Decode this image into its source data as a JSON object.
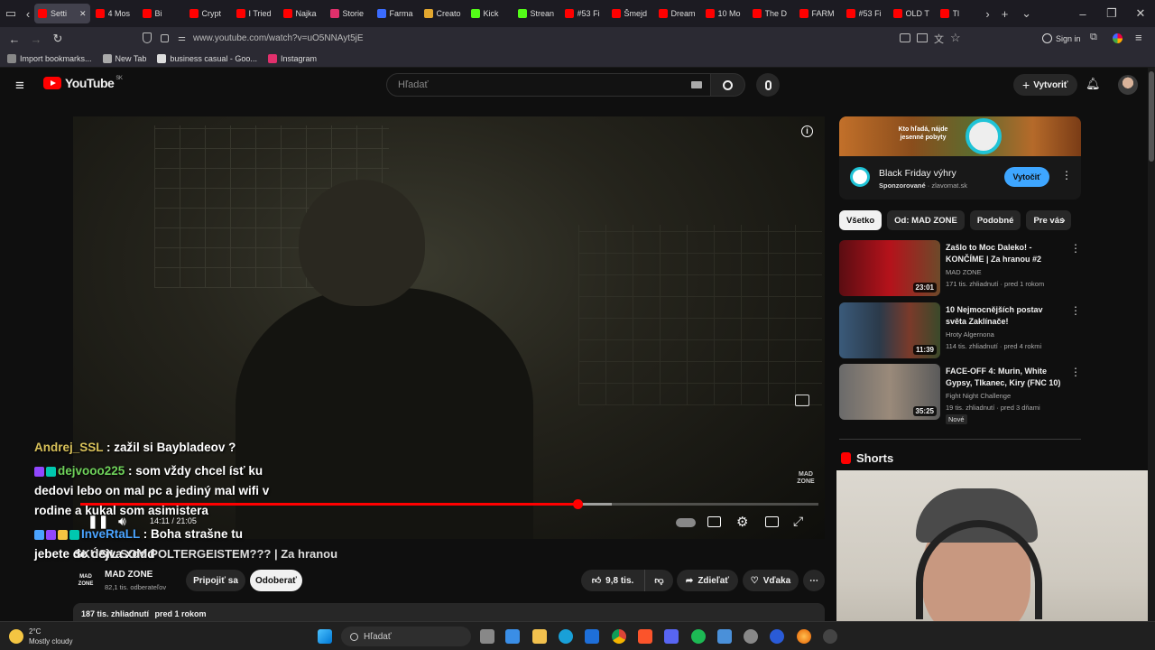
{
  "browser": {
    "tabs": [
      {
        "title": "Setti",
        "color": "#ff0000",
        "active": true
      },
      {
        "title": "4 Mos",
        "color": "#ff0000"
      },
      {
        "title": "Bi",
        "color": "#ff0000"
      },
      {
        "title": "Crypt",
        "color": "#ff0000"
      },
      {
        "title": "I Tried",
        "color": "#ff0000"
      },
      {
        "title": "Najka",
        "color": "#ff0000"
      },
      {
        "title": "Storie",
        "color": "#e1306c"
      },
      {
        "title": "Farma",
        "color": "#3b6cff"
      },
      {
        "title": "Creato",
        "color": "#e3a72f"
      },
      {
        "title": "Kick",
        "color": "#53fc18"
      },
      {
        "title": "Strean",
        "color": "#53fc18"
      },
      {
        "title": "#53 Fi",
        "color": "#ff0000"
      },
      {
        "title": "Šmejd",
        "color": "#ff0000"
      },
      {
        "title": "Dream",
        "color": "#ff0000"
      },
      {
        "title": "10 Mo",
        "color": "#ff0000"
      },
      {
        "title": "The D",
        "color": "#ff0000"
      },
      {
        "title": "FARM",
        "color": "#ff0000"
      },
      {
        "title": "#53 Fi",
        "color": "#ff0000"
      },
      {
        "title": "OLD T",
        "color": "#ff0000"
      },
      {
        "title": "Tl",
        "color": "#ff0000"
      }
    ],
    "url": "www.youtube.com/watch?v=uO5NNAyt5jE",
    "sign_in": "Sign in",
    "bookmarks": [
      {
        "label": "Import bookmarks...",
        "color": "#888888"
      },
      {
        "label": "New Tab",
        "color": "#aaaaaa"
      },
      {
        "label": "business casual - Goo...",
        "color": "#dddddd"
      },
      {
        "label": "Instagram",
        "color": "#e1306c"
      }
    ]
  },
  "youtube": {
    "logo_text": "YouTube",
    "region": "SK",
    "search_placeholder": "Hľadať",
    "create_label": "Vytvoriť",
    "video": {
      "time_current": "14:11",
      "time_total": "21:05",
      "timecode": "14:11 / 21:05",
      "progress_fraction": 0.673,
      "buffered_fraction": 0.72,
      "watermark": "MAD ZONE",
      "title": "SKÚSIL SOM POLTERGEISTEM??? | Za hranou"
    },
    "channel": {
      "name": "MAD ZONE",
      "subscribers": "82,1 tis. odberateľov",
      "join_label": "Pripojiť sa",
      "subscribe_label": "Odoberať",
      "likes": "9,8 tis.",
      "share_label": "Zdieľať",
      "thanks_label": "Vďaka"
    },
    "description": {
      "views": "187 tis. zhliadnutí",
      "date": "pred 1 rokom"
    },
    "ad": {
      "banner_text": "Kto hľadá, nájde jesenné pobyty",
      "title": "Black Friday výhry",
      "sponsored": "Sponzorované",
      "domain": "zlavomat.sk",
      "cta": "Vytočiť"
    },
    "chips": [
      "Všetko",
      "Od: MAD ZONE",
      "Podobné",
      "Pre vás"
    ],
    "recommendations": [
      {
        "title": "Zašlo to Moc Daleko! - KONČÍME | Za hranou #2",
        "channel": "MAD ZONE",
        "meta": "171 tis. zhliadnutí · pred 1 rokom",
        "duration": "23:01",
        "badge": ""
      },
      {
        "title": "10 Nejmocnějších postav světa Zaklínače!",
        "channel": "Hroty Algernona",
        "meta": "114 tis. zhliadnutí · pred 4 rokmi",
        "duration": "11:39",
        "badge": ""
      },
      {
        "title": "FACE-OFF 4: Murin, White Gypsy, Tlkanec, Kiry (FNC 10)",
        "channel": "Fight Night Challenge",
        "meta": "19 tis. zhliadnutí · pred 3 dňami",
        "duration": "35:25",
        "badge": "Nové"
      }
    ],
    "shorts_label": "Shorts"
  },
  "chat": [
    {
      "user": "Andrej_SSL",
      "text": ": zažil si Baybladeov ?"
    },
    {
      "user": "dejvooo225",
      "text": ": som vždy chcel ísť ku dedovi lebo on mal pc a jediný mal wifi v rodine a kukal som asimistera"
    },
    {
      "user": "InveRtaLL",
      "text": ": Boha strašne tu jebete do dejva xddd"
    }
  ],
  "taskbar": {
    "temperature": "2°C",
    "weather": "Mostly cloudy",
    "search_label": "Hľadať"
  }
}
